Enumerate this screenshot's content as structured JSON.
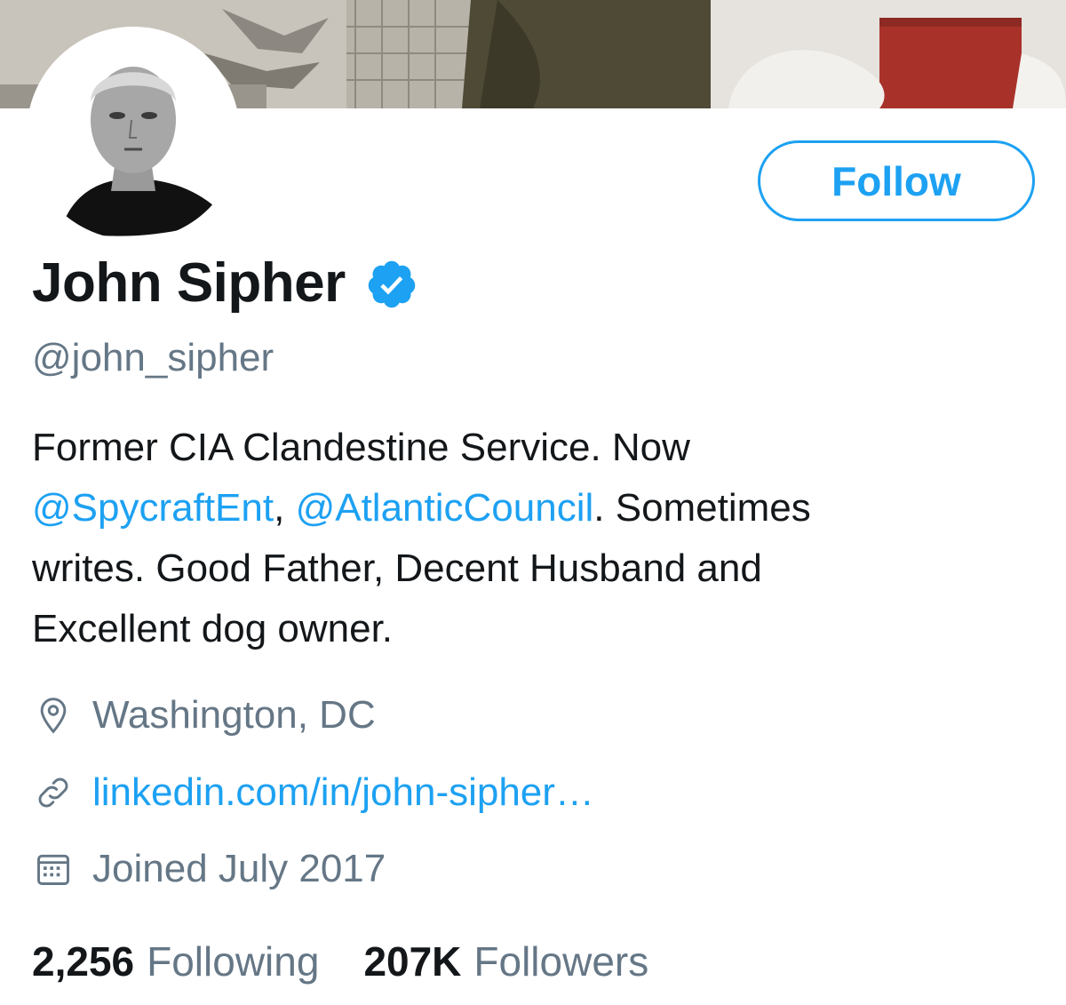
{
  "profile": {
    "name": "John Sipher",
    "handle": "@john_sipher",
    "follow_label": "Follow",
    "bio": {
      "line1": "Former CIA Clandestine Service. Now",
      "mention1": "@SpycraftEnt",
      "sep": ", ",
      "mention2": "@AtlanticCouncil",
      "rest1": ". Sometimes",
      "line3": "writes. Good Father, Decent Husband and",
      "line4": "Excellent dog owner."
    },
    "location": "Washington, DC",
    "website": "linkedin.com/in/john-sipher…",
    "joined": "Joined July 2017",
    "following_count": "2,256",
    "following_label": "Following",
    "followers_count": "207K",
    "followers_label": "Followers"
  },
  "icons": {
    "verified": "verified-badge-icon",
    "location": "location-pin-icon",
    "link": "link-icon",
    "calendar": "calendar-icon"
  },
  "colors": {
    "accent": "#1da1f2",
    "text": "#14171a",
    "secondary": "#657786"
  }
}
